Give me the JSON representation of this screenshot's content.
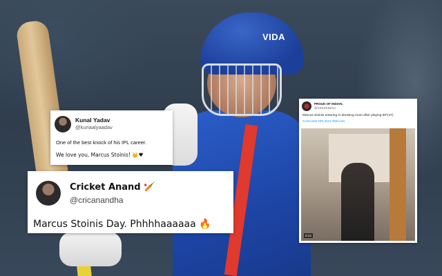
{
  "background": {
    "helmet_logo_text": "VIDA"
  },
  "tweets": [
    {
      "name": "Kunal Yadav",
      "handle": "@kunaalyaadav",
      "lines": [
        "One of the best knock of his IPL career.",
        "We love you, Marcus Stoinis! 👑♥"
      ]
    },
    {
      "name": "Cricket Anand 🏏",
      "handle": "@cricanandha",
      "text": "Marcus Stoinis Day. Phhhhaaaaaa 🔥"
    },
    {
      "name": "PROUD OF INDIAN.",
      "handle": "@XKESKINGU",
      "text": "Marcus Stoinis entering in dressing room after playing 89*(47).",
      "hashtags": "#LSGvsMI #IPL2023 #MIvLSG",
      "video_timestamp": "0:13"
    }
  ]
}
